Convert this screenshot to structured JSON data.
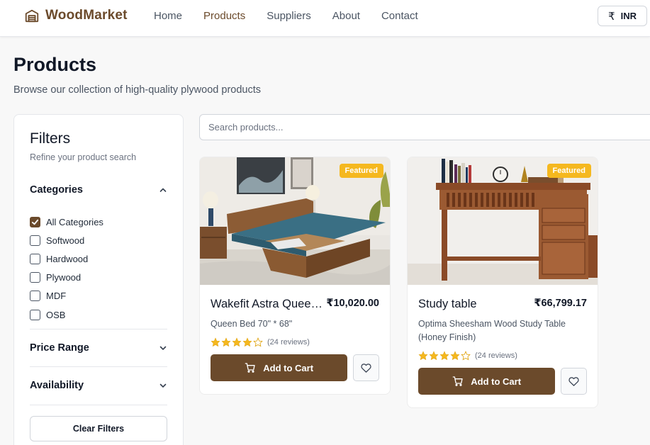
{
  "header": {
    "brand": "WoodMarket",
    "nav": [
      {
        "label": "Home"
      },
      {
        "label": "Products"
      },
      {
        "label": "Suppliers"
      },
      {
        "label": "About"
      },
      {
        "label": "Contact"
      }
    ],
    "active_nav": "Products",
    "currency_symbol": "₹",
    "currency": "INR"
  },
  "page": {
    "title": "Products",
    "subtitle": "Browse our collection of high-quality plywood products"
  },
  "filters": {
    "title": "Filters",
    "subtitle": "Refine your product search",
    "categories_label": "Categories",
    "categories": [
      {
        "label": "All Categories",
        "checked": true
      },
      {
        "label": "Softwood",
        "checked": false
      },
      {
        "label": "Hardwood",
        "checked": false
      },
      {
        "label": "Plywood",
        "checked": false
      },
      {
        "label": "MDF",
        "checked": false
      },
      {
        "label": "OSB",
        "checked": false
      }
    ],
    "price_label": "Price Range",
    "availability_label": "Availability",
    "clear_label": "Clear Filters"
  },
  "search": {
    "placeholder": "Search products...",
    "value": ""
  },
  "products": [
    {
      "badge": "Featured",
      "name": "Wakefit Astra Queen Bed",
      "price": "₹10,020.00",
      "description": "Queen Bed 70\" * 68\"",
      "rating": 4,
      "reviews": "(24 reviews)",
      "cart_label": "Add to Cart"
    },
    {
      "badge": "Featured",
      "name": "Study table",
      "price": "₹66,799.17",
      "description": "Optima Sheesham Wood Study Table (Honey Finish)",
      "rating": 4,
      "reviews": "(24 reviews)",
      "cart_label": "Add to Cart"
    }
  ],
  "colors": {
    "brand": "#6b4a2b",
    "badge": "#f5b81f",
    "star": "#f5b81f"
  }
}
